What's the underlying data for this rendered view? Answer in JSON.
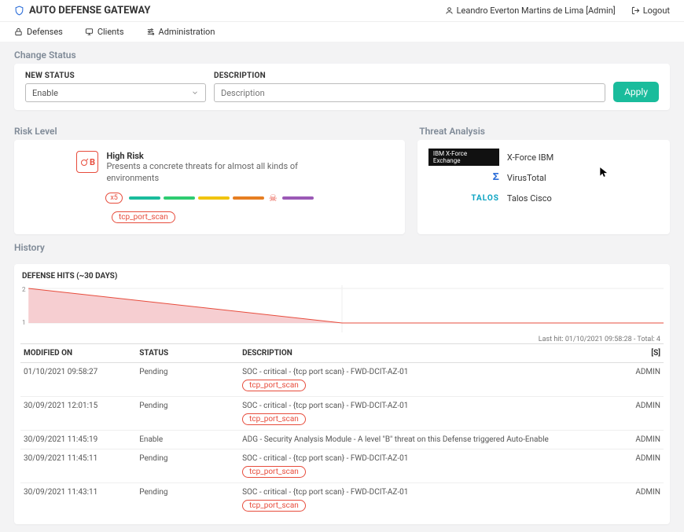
{
  "brand": "AUTO DEFENSE GATEWAY",
  "user": {
    "label": "Leandro Everton Martins de Lima [Admin]"
  },
  "logout": "Logout",
  "nav": {
    "defenses": "Defenses",
    "clients": "Clients",
    "admin": "Administration"
  },
  "change_status": {
    "title": "Change Status",
    "new_status_label": "NEW STATUS",
    "selected": "Enable",
    "desc_label": "DESCRIPTION",
    "desc_placeholder": "Description",
    "apply": "Apply"
  },
  "risk": {
    "title": "Risk Level",
    "badge": "B",
    "heading": "High Risk",
    "desc": "Presents a concrete threats for almost all kinds of environments",
    "x5": "x5",
    "tag": "tcp_port_scan"
  },
  "threat": {
    "title": "Threat Analysis",
    "items": [
      {
        "logo_text": "IBM  X-Force Exchange",
        "logo_kind": "xforce",
        "label": "X-Force IBM"
      },
      {
        "logo_text": "Σ",
        "logo_kind": "vt",
        "label": "VirusTotal"
      },
      {
        "logo_text": "TALOS",
        "logo_kind": "talos",
        "label": "Talos Cisco"
      }
    ]
  },
  "history": {
    "title": "History",
    "chart_title": "DEFENSE HITS (~30 DAYS)",
    "chart_note": "Last hit: 01/10/2021 09:58:28 - Total: 4",
    "cols": {
      "modified": "MODIFIED ON",
      "status": "STATUS",
      "desc": "DESCRIPTION",
      "by": "[S]"
    },
    "rows": [
      {
        "modified": "01/10/2021 09:58:27",
        "status": "Pending",
        "desc": "SOC - critical - {tcp port scan} - FWD-DCIT-AZ-01",
        "tag": "tcp_port_scan",
        "by": "ADMIN"
      },
      {
        "modified": "30/09/2021 12:01:15",
        "status": "Pending",
        "desc": "SOC - critical - {tcp port scan} - FWD-DCIT-AZ-01",
        "tag": "tcp_port_scan",
        "by": "ADMIN"
      },
      {
        "modified": "30/09/2021 11:45:19",
        "status": "Enable",
        "desc": "ADG - Security Analysis Module - A level \"B\" threat on this Defense triggered Auto-Enable",
        "tag": "",
        "by": "ADMIN"
      },
      {
        "modified": "30/09/2021 11:45:11",
        "status": "Pending",
        "desc": "SOC - critical - {tcp port scan} - FWD-DCIT-AZ-01",
        "tag": "tcp_port_scan",
        "by": "ADMIN"
      },
      {
        "modified": "30/09/2021 11:43:11",
        "status": "Pending",
        "desc": "SOC - critical - {tcp port scan} - FWD-DCIT-AZ-01",
        "tag": "tcp_port_scan",
        "by": "ADMIN"
      }
    ]
  },
  "chart_data": {
    "type": "area",
    "title": "DEFENSE HITS (~30 DAYS)",
    "xlabel": "",
    "ylabel": "",
    "ylim": [
      1,
      2
    ],
    "x": [
      0,
      0.5,
      1.0
    ],
    "values": [
      2,
      1,
      1
    ],
    "note": "linear decline from 2 to 1 over first half of 30-day window, then flat at 1"
  }
}
